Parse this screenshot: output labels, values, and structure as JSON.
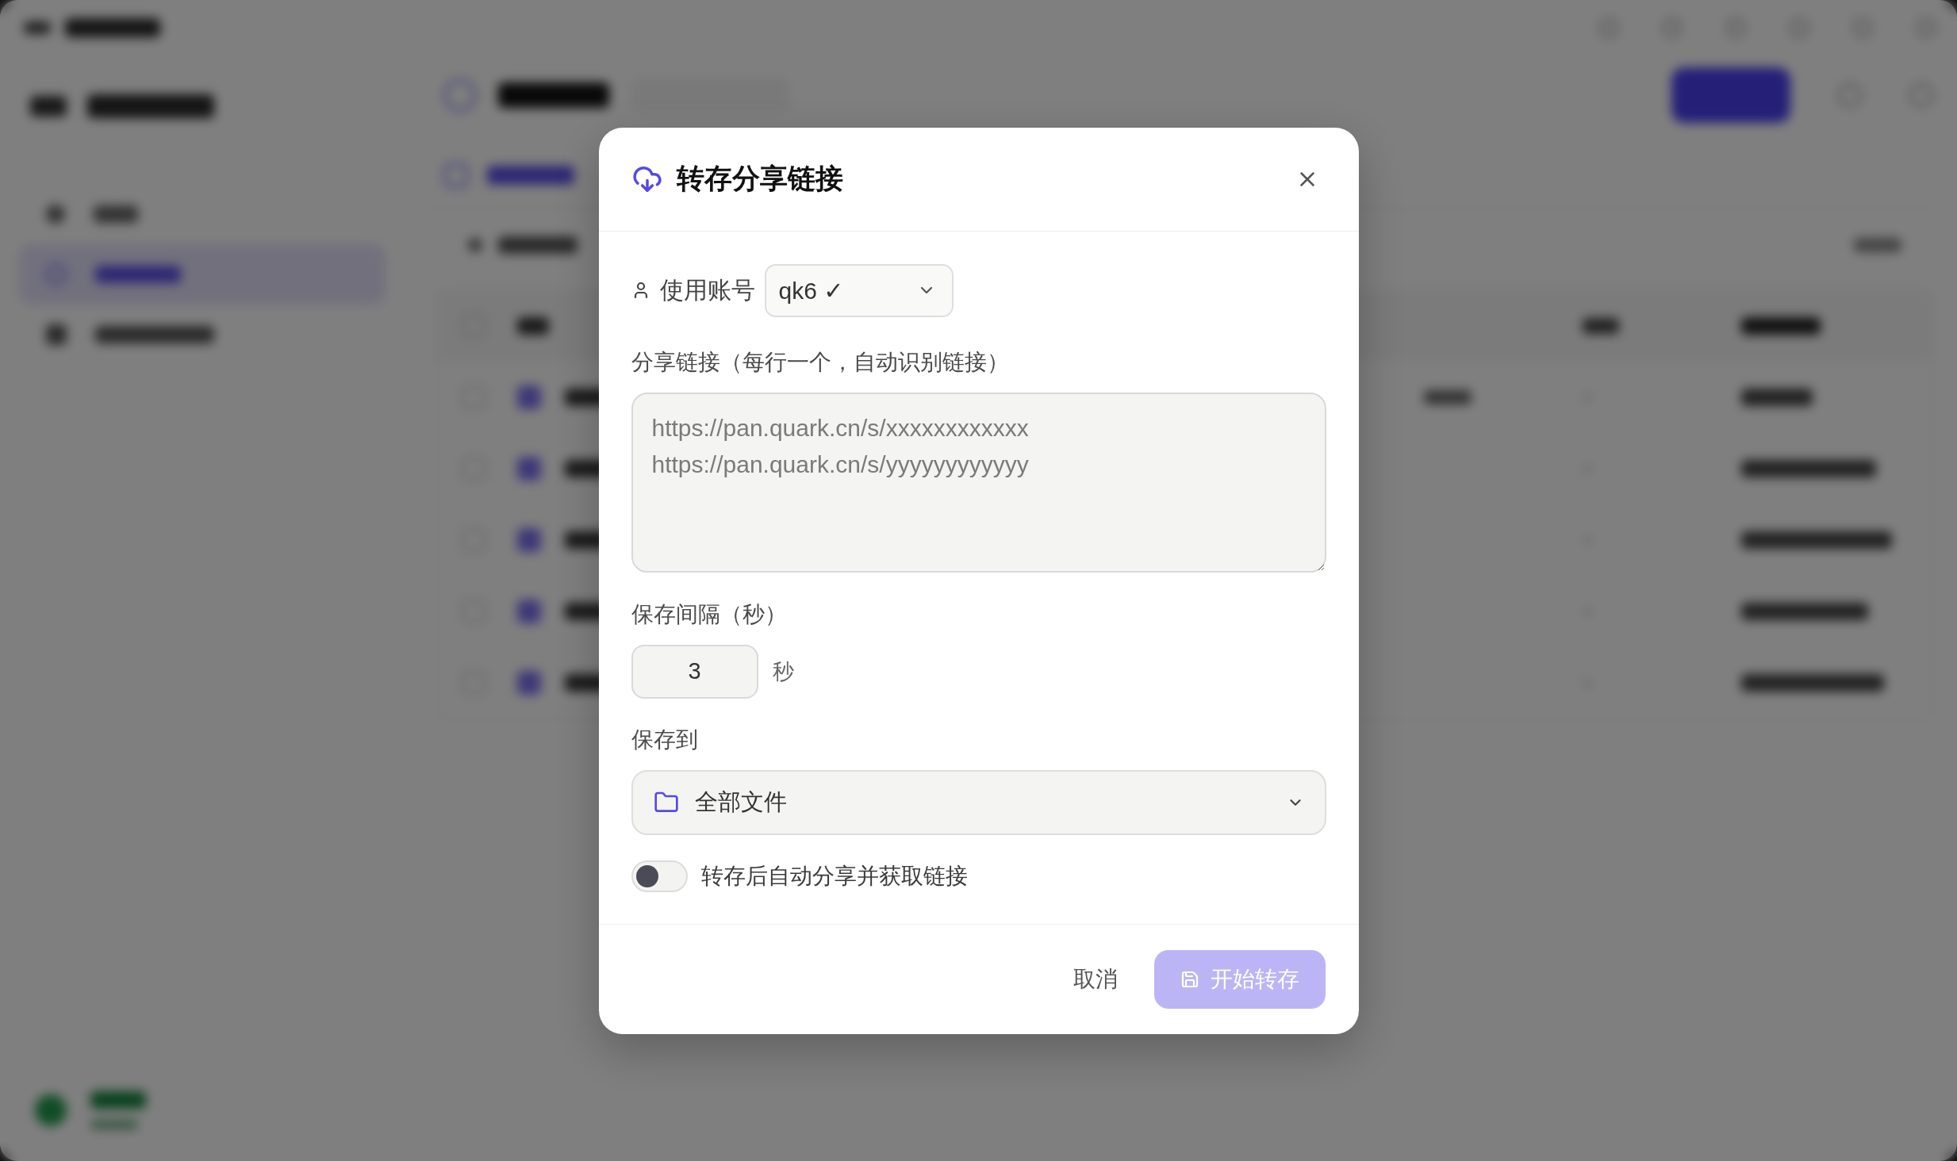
{
  "dialog": {
    "title": "转存分享链接",
    "account": {
      "label": "使用账号",
      "value": "qk6 ✓"
    },
    "links": {
      "label": "分享链接（每行一个，自动识别链接）",
      "placeholder": "https://pan.quark.cn/s/xxxxxxxxxxxx\nhttps://pan.quark.cn/s/yyyyyyyyyyyy"
    },
    "interval": {
      "label": "保存间隔（秒）",
      "value": "3",
      "unit": "秒"
    },
    "destination": {
      "label": "保存到",
      "value": "全部文件"
    },
    "auto_share": {
      "label": "转存后自动分享并获取链接",
      "on": false
    },
    "buttons": [
      {
        "label": "取消",
        "kind": "secondary",
        "disabled": false
      },
      {
        "label": "开始转存",
        "kind": "primary",
        "disabled": true
      }
    ]
  }
}
